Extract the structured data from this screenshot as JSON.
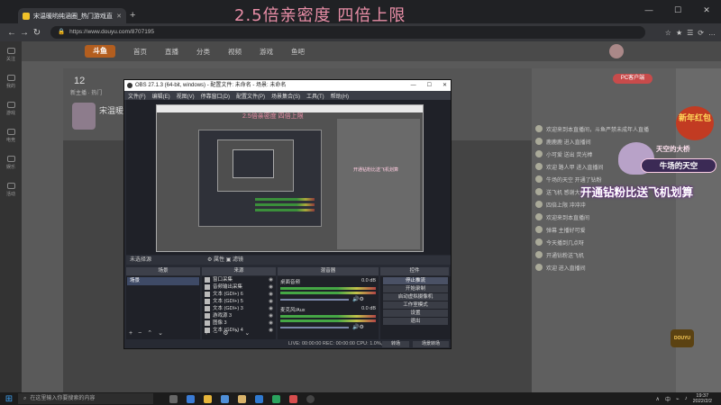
{
  "overlay_title": "2.5倍亲密度 四倍上限",
  "browser": {
    "tab_title": "宋温暖哟纯涵圈_热门游戏直播",
    "tab_close": "✕",
    "new_tab": "+",
    "url": "https://www.douyu.com/8707195",
    "window_controls": [
      "—",
      "☐",
      "✕"
    ],
    "nav": [
      "←",
      "→",
      "↻"
    ],
    "right_icons": [
      "☆",
      "★",
      "☰",
      "⟳",
      "…"
    ]
  },
  "site": {
    "logo": "斗鱼",
    "nav_items": [
      "首页",
      "直播",
      "分类",
      "视频",
      "游戏",
      "鱼吧"
    ],
    "rail_items": [
      "关注",
      "我的",
      "游戏",
      "电竞",
      "娱乐",
      "活动"
    ],
    "room_number": "12",
    "room_sub": "新主播 · 热门",
    "anchor_name": "宋温暖",
    "pc_button": "PC客户端",
    "chat_lines": [
      "欢迎来到本直播间，斗鱼严禁未成年人直播",
      "鹿鹿鹿 进入直播间",
      "小可爱 送出 荧光棒",
      "欢迎 路人甲 进入直播间",
      "牛场的天空 开通了钻粉",
      "送飞机 感谢大佬",
      "四倍上限 冲冲冲",
      "欢迎来到本直播间",
      "弹幕 主播好可爱",
      "今天播到几点呀",
      "开通钻粉送飞机",
      "欢迎 进入直播间"
    ]
  },
  "overlays": {
    "new_year_badge": "新年红包",
    "vtuber_top": "天空的大桥",
    "vtuber_tag": "牛场的天空",
    "promo": "开通钻粉比送飞机划算",
    "corner_logo": "DOUYU"
  },
  "obs": {
    "title": "OBS 27.1.3 (64-bit, windows) - 配置文件: 未命名 - 场景: 未命名",
    "title_controls": [
      "—",
      "☐",
      "✕"
    ],
    "menu": [
      "文件(F)",
      "编辑(E)",
      "视图(V)",
      "停靠窗口(D)",
      "配置文件(P)",
      "场景集合(S)",
      "工具(T)",
      "帮助(H)"
    ],
    "nested_title": "2.5倍亲密度 四倍上限",
    "nested_overlay": "开通钻粉比送飞机划算",
    "scene_status": "未选择源",
    "scene_status_sub": "⚙ 属性   ▣ 滤镜",
    "docks": {
      "scenes": "场景",
      "sources": "来源",
      "mixer": "混音器",
      "transitions": "转场",
      "controls": "控件"
    },
    "scenes": [
      "场景"
    ],
    "sources": [
      "窗口采集",
      "音频输出采集",
      "文本 (GDI+) 6",
      "文本 (GDI+) 5",
      "文本 (GDI+) 3",
      "游戏源 3",
      "图像 3",
      "文本 (GDI+) 4"
    ],
    "mixer": [
      {
        "name": "桌面音频",
        "db": "0.0 dB"
      },
      {
        "name": "麦克风/Aux",
        "db": "0.0 dB"
      }
    ],
    "controls": [
      "停止推流",
      "开始录制",
      "启动虚拟摄像机",
      "工作室模式",
      "设置",
      "退出"
    ],
    "dock_footer": [
      "+",
      "−",
      "⌃",
      "⌄"
    ],
    "statusbar": "LIVE: 00:00:00   REC: 00:00:00   CPU: 1.0%, 60.00 fps",
    "bottom_buttons": [
      "转场",
      "场景转场"
    ]
  },
  "taskbar": {
    "start": "⊞",
    "search_placeholder": "在这里输入你要搜索的内容",
    "tray": [
      "∧",
      "中",
      "⌁",
      "♪"
    ],
    "time": "19:37",
    "date": "2022/2/2"
  }
}
